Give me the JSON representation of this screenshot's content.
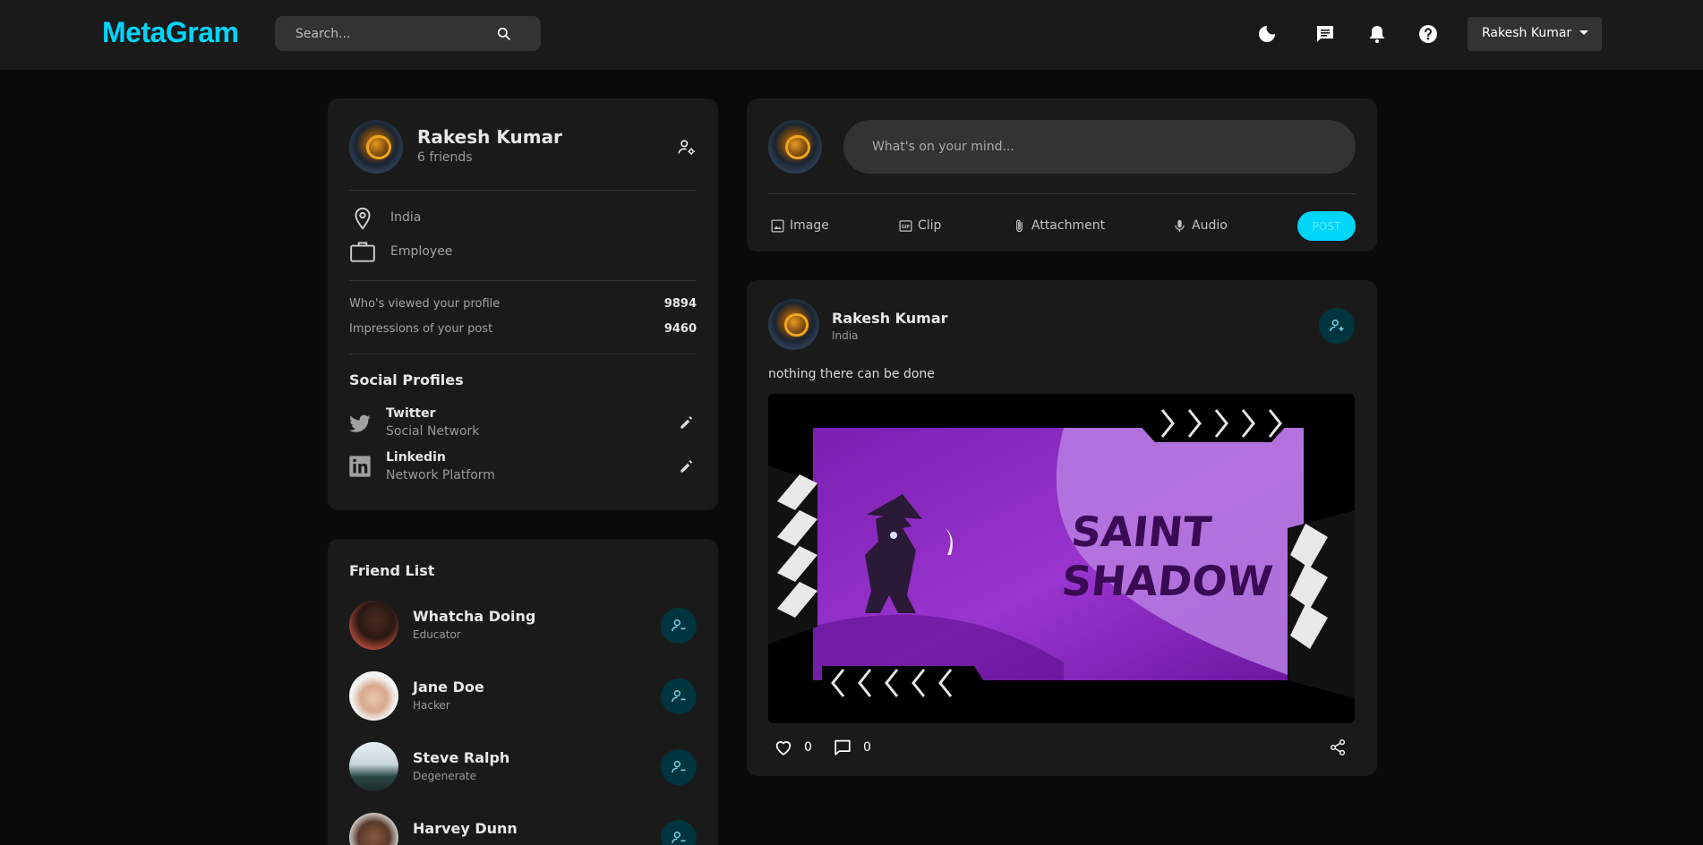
{
  "navbar": {
    "logo": "MetaGram",
    "search_placeholder": "Search...",
    "user_name": "Rakesh Kumar"
  },
  "profile": {
    "name": "Rakesh Kumar",
    "friends": "6 friends",
    "location": "India",
    "occupation": "Employee",
    "stats": [
      {
        "label": "Who's viewed your profile",
        "value": "9894"
      },
      {
        "label": "Impressions of your post",
        "value": "9460"
      }
    ],
    "social_title": "Social Profiles",
    "socials": [
      {
        "name": "Twitter",
        "type": "Social Network"
      },
      {
        "name": "Linkedin",
        "type": "Network Platform"
      }
    ]
  },
  "friend_list": {
    "title": "Friend List",
    "friends": [
      {
        "name": "Whatcha Doing",
        "role": "Educator"
      },
      {
        "name": "Jane Doe",
        "role": "Hacker"
      },
      {
        "name": "Steve Ralph",
        "role": "Degenerate"
      },
      {
        "name": "Harvey Dunn",
        "role": ""
      }
    ]
  },
  "composer": {
    "placeholder": "What's on your mind...",
    "actions": [
      "Image",
      "Clip",
      "Attachment",
      "Audio"
    ],
    "post_label": "POST"
  },
  "post": {
    "author": "Rakesh Kumar",
    "location": "India",
    "text": "nothing there can be done",
    "image_text_1": "SAINT",
    "image_text_2": "SHADOW",
    "likes": "0",
    "comments": "0"
  },
  "colors": {
    "accent": "#00d5fa",
    "card": "#1a1a1a",
    "background": "#0a0a0a",
    "purple": "#8e2ec4"
  }
}
